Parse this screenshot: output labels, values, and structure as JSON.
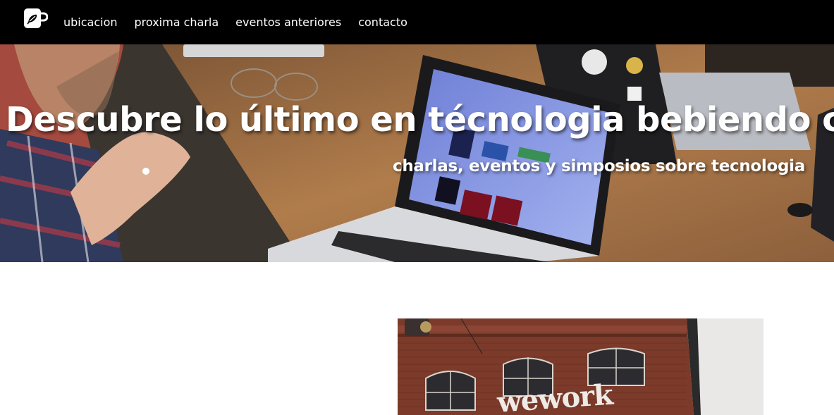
{
  "nav": {
    "logo_icon": "coffee-mug-leaf-icon",
    "items": [
      {
        "label": "ubicacion"
      },
      {
        "label": "proxima charla"
      },
      {
        "label": "eventos anteriores"
      },
      {
        "label": "contacto"
      }
    ]
  },
  "hero": {
    "title": "Descubre lo último en técnologia bebiendo café",
    "subtitle": "charlas, eventos y simposios sobre tecnologia",
    "image_description": "people working with laptops on a wooden table"
  },
  "content": {
    "photo_sign_text": "wework",
    "photo_description": "brick building with wework sign"
  },
  "colors": {
    "navbar_bg": "#000000",
    "nav_text": "#ffffff",
    "hero_text": "#ffffff",
    "page_bg": "#ffffff"
  }
}
